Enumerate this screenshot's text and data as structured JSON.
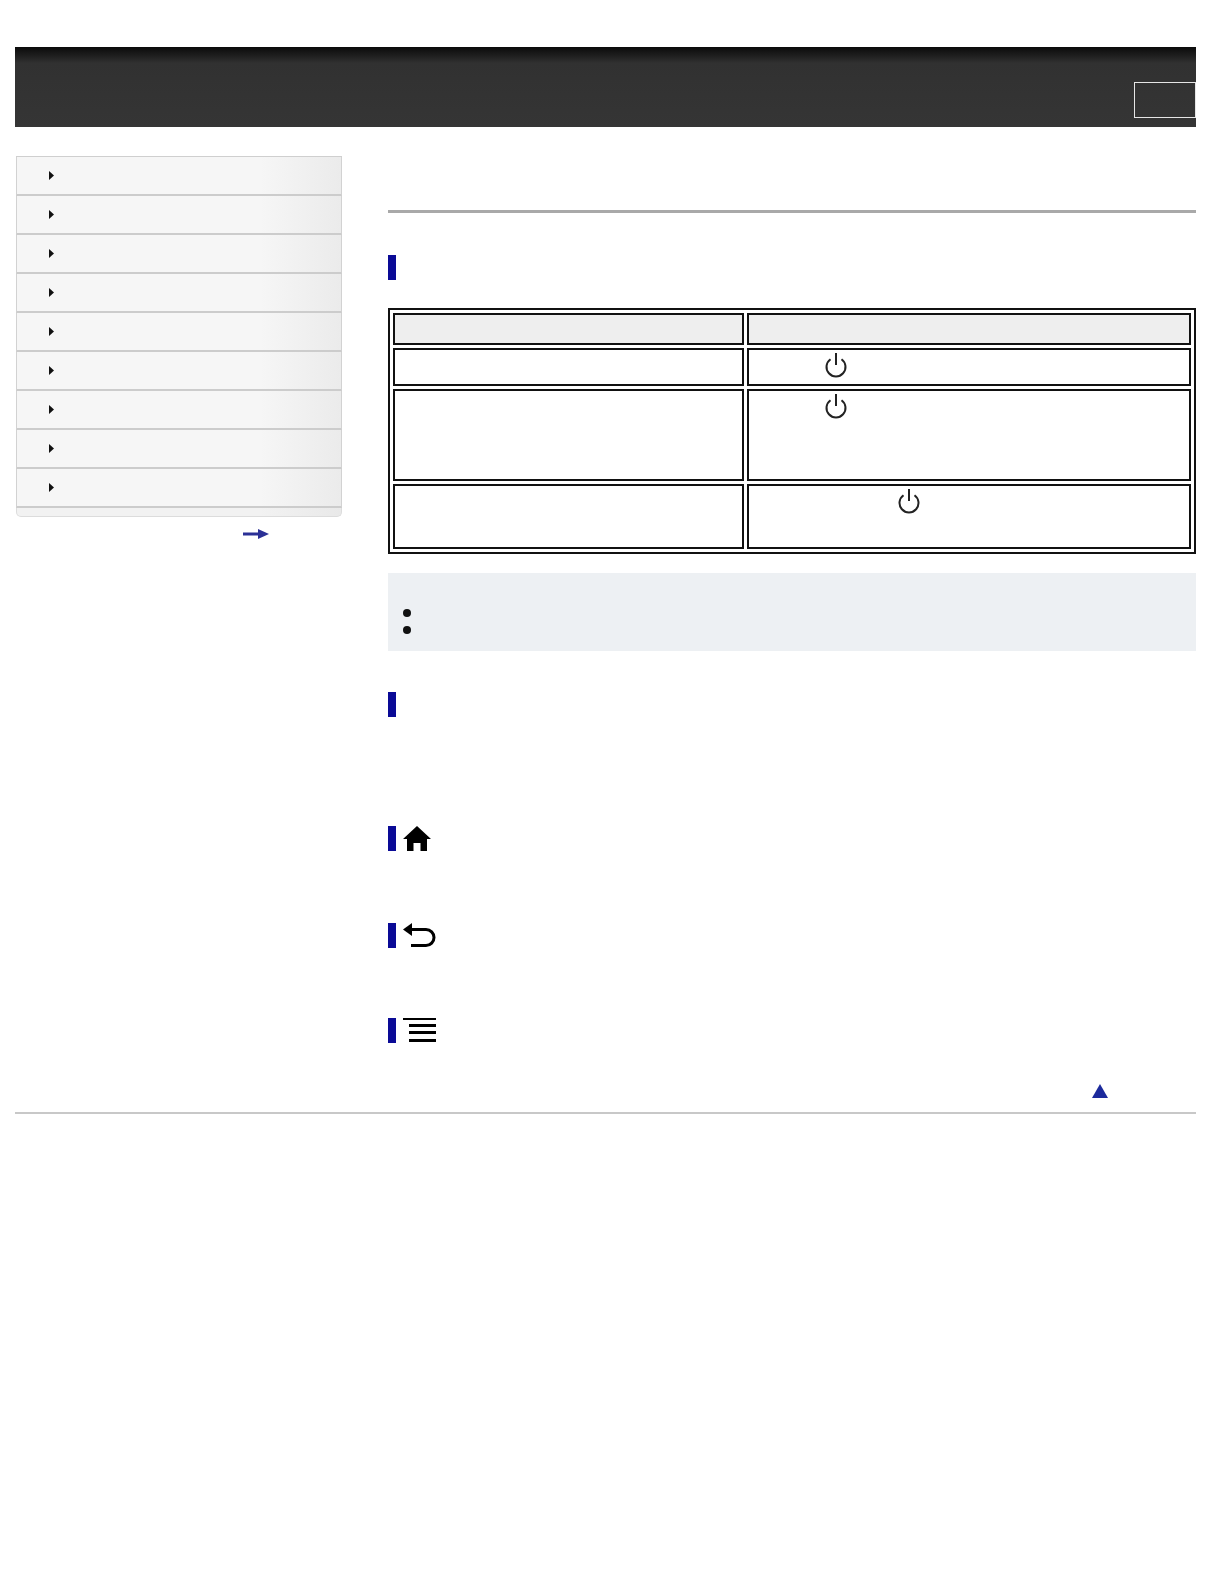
{
  "sidebar": {
    "items": [
      {
        "expanded": false
      },
      {
        "expanded": false
      },
      {
        "expanded": false
      },
      {
        "expanded": false
      },
      {
        "expanded": false
      },
      {
        "expanded": false
      },
      {
        "expanded": false
      },
      {
        "expanded": false
      },
      {
        "expanded": false
      }
    ]
  },
  "sections": [
    {
      "kind": "plain",
      "table": {
        "rows": [
          {
            "kind": "header",
            "cells": [
              {
                "kind": "blank"
              },
              {
                "kind": "blank"
              }
            ]
          },
          {
            "kind": "body",
            "cells": [
              {
                "kind": "blank"
              },
              {
                "kind": "power"
              }
            ]
          },
          {
            "kind": "body",
            "cells": [
              {
                "kind": "blank"
              },
              {
                "kind": "power"
              }
            ]
          },
          {
            "kind": "body",
            "cells": [
              {
                "kind": "blank"
              },
              {
                "kind": "power"
              }
            ]
          }
        ]
      },
      "note": {
        "bullets": [
          {
            "kind": "dot"
          },
          {
            "kind": "dot"
          }
        ]
      }
    },
    {
      "kind": "plain"
    },
    {
      "kind": "home"
    },
    {
      "kind": "back"
    },
    {
      "kind": "menu"
    }
  ]
}
